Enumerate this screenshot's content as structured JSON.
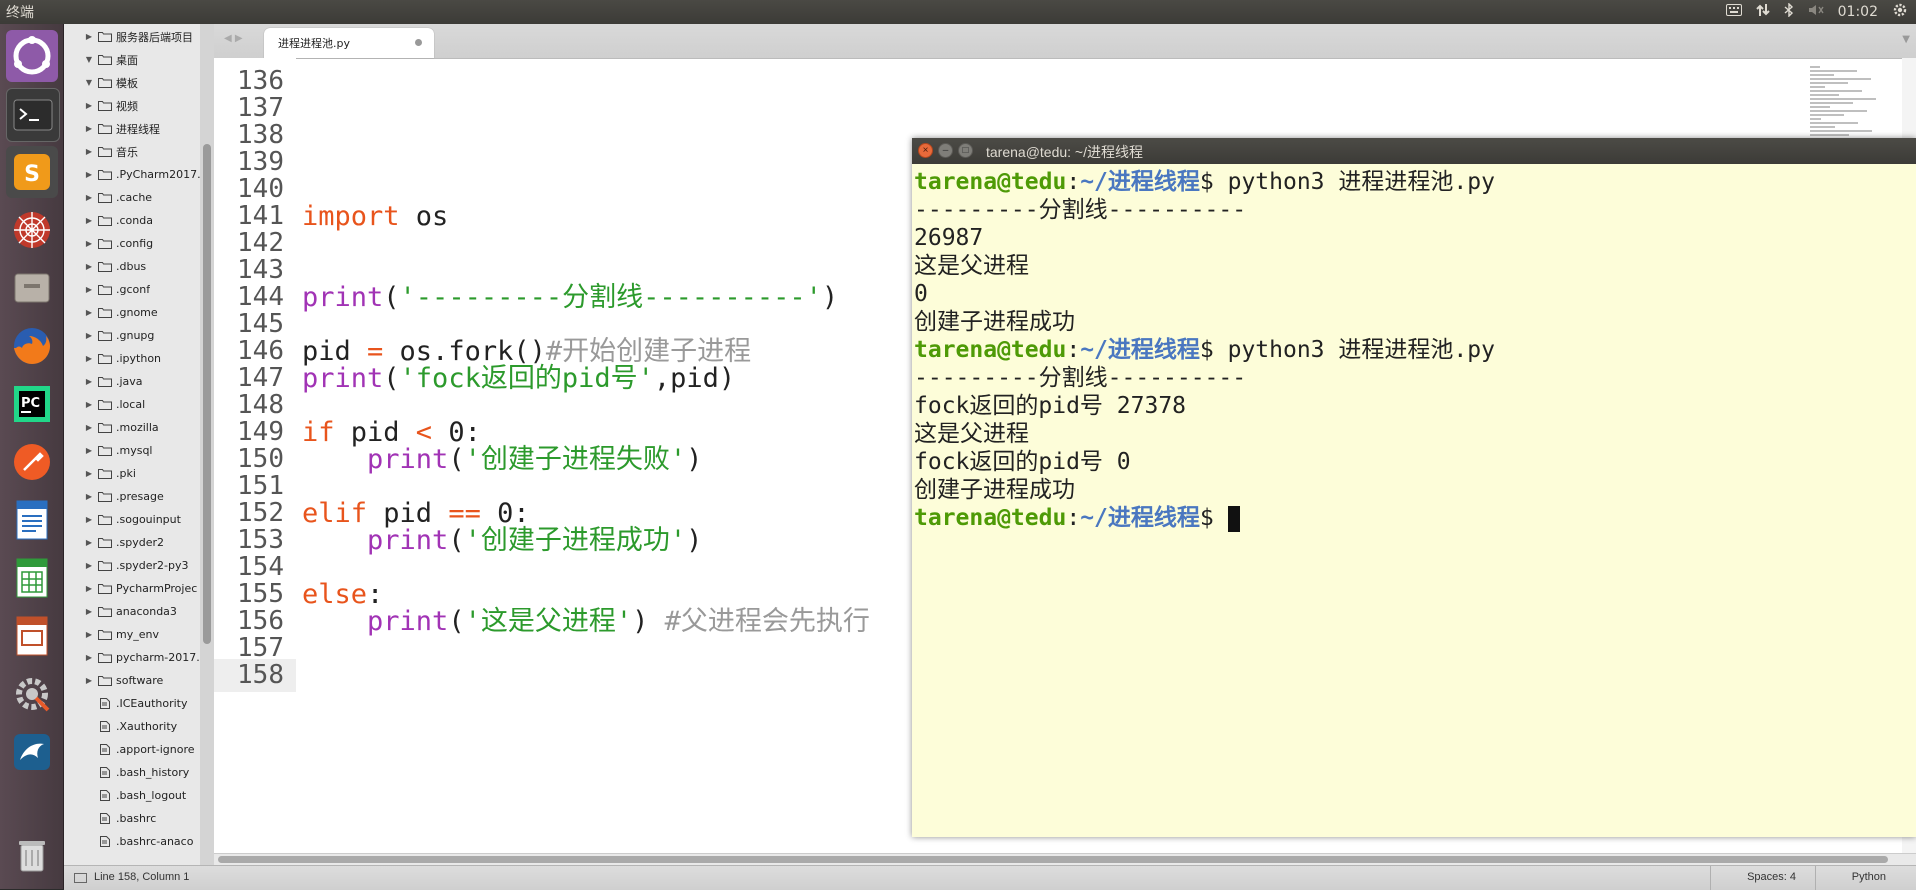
{
  "top_panel": {
    "title": "终端",
    "time": "01:02",
    "indicators": [
      "keyboard-icon",
      "network-icon",
      "bluetooth-icon",
      "volume-icon",
      "settings-gear-icon"
    ]
  },
  "launcher": {
    "items": [
      "ubuntu-dash-icon",
      "terminal-icon",
      "sublime-text-icon",
      "spider-web-icon",
      "file-manager-icon",
      "firefox-icon",
      "pycharm-icon",
      "postman-icon",
      "writer-icon",
      "calc-icon",
      "impress-icon",
      "system-settings-icon",
      "mysql-workbench-icon",
      "trash-icon"
    ]
  },
  "sidebar": {
    "items": [
      {
        "label": "服务器后端项目",
        "type": "folder",
        "expanded": false,
        "indent": 1
      },
      {
        "label": "桌面",
        "type": "folder",
        "expanded": true,
        "indent": 1
      },
      {
        "label": "模板",
        "type": "folder",
        "expanded": true,
        "indent": 1
      },
      {
        "label": "视频",
        "type": "folder",
        "expanded": false,
        "indent": 1
      },
      {
        "label": "进程线程",
        "type": "folder",
        "expanded": false,
        "indent": 1
      },
      {
        "label": "音乐",
        "type": "folder",
        "expanded": false,
        "indent": 1
      },
      {
        "label": ".PyCharm2017.",
        "type": "folder",
        "expanded": false,
        "indent": 1
      },
      {
        "label": ".cache",
        "type": "folder",
        "expanded": false,
        "indent": 1
      },
      {
        "label": ".conda",
        "type": "folder",
        "expanded": false,
        "indent": 1
      },
      {
        "label": ".config",
        "type": "folder",
        "expanded": false,
        "indent": 1
      },
      {
        "label": ".dbus",
        "type": "folder",
        "expanded": false,
        "indent": 1
      },
      {
        "label": ".gconf",
        "type": "folder",
        "expanded": false,
        "indent": 1
      },
      {
        "label": ".gnome",
        "type": "folder",
        "expanded": false,
        "indent": 1
      },
      {
        "label": ".gnupg",
        "type": "folder",
        "expanded": false,
        "indent": 1
      },
      {
        "label": ".ipython",
        "type": "folder",
        "expanded": false,
        "indent": 1
      },
      {
        "label": ".java",
        "type": "folder",
        "expanded": false,
        "indent": 1
      },
      {
        "label": ".local",
        "type": "folder",
        "expanded": false,
        "indent": 1
      },
      {
        "label": ".mozilla",
        "type": "folder",
        "expanded": false,
        "indent": 1
      },
      {
        "label": ".mysql",
        "type": "folder",
        "expanded": false,
        "indent": 1
      },
      {
        "label": ".pki",
        "type": "folder",
        "expanded": false,
        "indent": 1
      },
      {
        "label": ".presage",
        "type": "folder",
        "expanded": false,
        "indent": 1
      },
      {
        "label": ".sogouinput",
        "type": "folder",
        "expanded": false,
        "indent": 1
      },
      {
        "label": ".spyder2",
        "type": "folder",
        "expanded": false,
        "indent": 1
      },
      {
        "label": ".spyder2-py3",
        "type": "folder",
        "expanded": false,
        "indent": 1
      },
      {
        "label": "PycharmProjec",
        "type": "folder",
        "expanded": false,
        "indent": 1
      },
      {
        "label": "anaconda3",
        "type": "folder",
        "expanded": false,
        "indent": 1
      },
      {
        "label": "my_env",
        "type": "folder",
        "expanded": false,
        "indent": 1
      },
      {
        "label": "pycharm-2017.",
        "type": "folder",
        "expanded": false,
        "indent": 1
      },
      {
        "label": "software",
        "type": "folder",
        "expanded": false,
        "indent": 1
      },
      {
        "label": ".ICEauthority",
        "type": "file",
        "indent": 1
      },
      {
        "label": ".Xauthority",
        "type": "file",
        "indent": 1
      },
      {
        "label": ".apport-ignore",
        "type": "file",
        "indent": 1
      },
      {
        "label": ".bash_history",
        "type": "file",
        "indent": 1
      },
      {
        "label": ".bash_logout",
        "type": "file",
        "indent": 1
      },
      {
        "label": ".bashrc",
        "type": "file",
        "indent": 1
      },
      {
        "label": ".bashrc-anaco",
        "type": "file",
        "indent": 1
      }
    ]
  },
  "editor": {
    "tab_label": "进程进程池.py",
    "line_numbers": [
      "136",
      "137",
      "138",
      "139",
      "140",
      "141",
      "142",
      "143",
      "144",
      "145",
      "146",
      "147",
      "148",
      "149",
      "150",
      "151",
      "152",
      "153",
      "154",
      "155",
      "156",
      "157",
      "158"
    ],
    "current_line": "158",
    "code_lines": [
      [],
      [],
      [],
      [],
      [],
      [
        {
          "t": "kw",
          "v": "import"
        },
        {
          "t": "",
          "v": " os"
        }
      ],
      [],
      [],
      [
        {
          "t": "fn",
          "v": "print"
        },
        {
          "t": "",
          "v": "("
        },
        {
          "t": "str",
          "v": "'---------分割线----------'"
        },
        {
          "t": "",
          "v": ")"
        }
      ],
      [],
      [
        {
          "t": "",
          "v": "pid "
        },
        {
          "t": "op",
          "v": "="
        },
        {
          "t": "",
          "v": " os.fork()"
        },
        {
          "t": "cm",
          "v": "#开始创建子进程"
        }
      ],
      [
        {
          "t": "fn",
          "v": "print"
        },
        {
          "t": "",
          "v": "("
        },
        {
          "t": "str",
          "v": "'fock返回的pid号'"
        },
        {
          "t": "",
          "v": ",pid)"
        }
      ],
      [],
      [
        {
          "t": "kw",
          "v": "if"
        },
        {
          "t": "",
          "v": " pid "
        },
        {
          "t": "op",
          "v": "<"
        },
        {
          "t": "",
          "v": " 0:"
        }
      ],
      [
        {
          "t": "",
          "v": "    "
        },
        {
          "t": "fn",
          "v": "print"
        },
        {
          "t": "",
          "v": "("
        },
        {
          "t": "str",
          "v": "'创建子进程失败'"
        },
        {
          "t": "",
          "v": ")"
        }
      ],
      [],
      [
        {
          "t": "kw",
          "v": "elif"
        },
        {
          "t": "",
          "v": " pid "
        },
        {
          "t": "op",
          "v": "=="
        },
        {
          "t": "",
          "v": " 0:"
        }
      ],
      [
        {
          "t": "",
          "v": "    "
        },
        {
          "t": "fn",
          "v": "print"
        },
        {
          "t": "",
          "v": "("
        },
        {
          "t": "str",
          "v": "'创建子进程成功'"
        },
        {
          "t": "",
          "v": ")"
        }
      ],
      [],
      [
        {
          "t": "kw",
          "v": "else"
        },
        {
          "t": "",
          "v": ":"
        }
      ],
      [
        {
          "t": "",
          "v": "    "
        },
        {
          "t": "fn",
          "v": "print"
        },
        {
          "t": "",
          "v": "("
        },
        {
          "t": "str",
          "v": "'这是父进程'"
        },
        {
          "t": "",
          "v": ") "
        },
        {
          "t": "cm",
          "v": "#父进程会先执行"
        }
      ],
      [],
      []
    ]
  },
  "statusbar": {
    "position": "Line 158, Column 1",
    "spaces": "Spaces: 4",
    "language": "Python"
  },
  "terminal": {
    "title": "tarena@tedu: ~/进程线程",
    "prompt_user": "tarena@tedu",
    "prompt_sep": ":",
    "prompt_path": "~/进程线程",
    "prompt_symbol": "$",
    "lines": [
      {
        "kind": "prompt",
        "cmd": " python3 进程进程池.py"
      },
      {
        "kind": "out",
        "text": "---------分割线----------"
      },
      {
        "kind": "out",
        "text": "26987"
      },
      {
        "kind": "out",
        "text": "这是父进程"
      },
      {
        "kind": "out",
        "text": "0"
      },
      {
        "kind": "out",
        "text": "创建子进程成功"
      },
      {
        "kind": "prompt",
        "cmd": " python3 进程进程池.py"
      },
      {
        "kind": "out",
        "text": "---------分割线----------"
      },
      {
        "kind": "out",
        "text": "fock返回的pid号 27378"
      },
      {
        "kind": "out",
        "text": "这是父进程"
      },
      {
        "kind": "out",
        "text": "fock返回的pid号 0"
      },
      {
        "kind": "out",
        "text": "创建子进程成功"
      },
      {
        "kind": "prompt",
        "cmd": " ",
        "cursor": true
      }
    ]
  },
  "colors": {
    "terminal_bg": "#fdfdd9",
    "prompt_user": "#4e9a06",
    "prompt_path": "#4a77c0",
    "keyword": "#e8541c",
    "function": "#a133b5",
    "string": "#2c9a2c",
    "comment": "#999999"
  }
}
